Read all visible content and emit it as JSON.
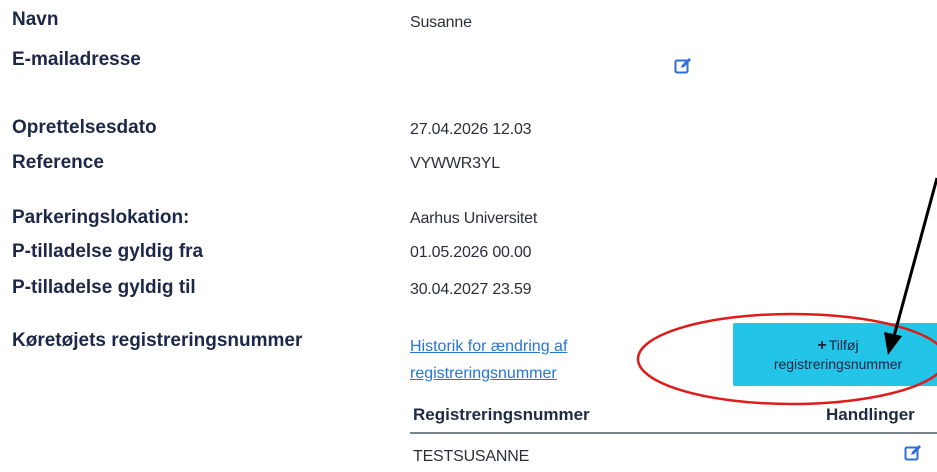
{
  "fields": {
    "name_label": "Navn",
    "name_value": "Susanne",
    "email_label": "E-mailadresse",
    "created_label": "Oprettelsesdato",
    "created_value": "27.04.2026 12.03",
    "reference_label": "Reference",
    "reference_value": "VYWWR3YL",
    "location_label": "Parkeringslokation:",
    "location_value": "Aarhus Universitet",
    "valid_from_label": "P-tilladelse gyldig fra",
    "valid_from_value": "01.05.2026 00.00",
    "valid_to_label": "P-tilladelse gyldig til",
    "valid_to_value": "30.04.2027 23.59",
    "plate_label": "Køretøjets registreringsnummer"
  },
  "history_link": {
    "line1": "Historik for ændring af",
    "line2": "registreringsnummer"
  },
  "add_button": {
    "plus": "+",
    "line1": "Tilføj",
    "line2": "registreringsnummer"
  },
  "table": {
    "headers": [
      "Registreringsnummer",
      "Handlinger"
    ],
    "rows": [
      {
        "plate": "TESTSUSANNE"
      }
    ]
  },
  "icons": {
    "email_edit": "edit-icon",
    "row_edit": "edit-icon"
  },
  "colors": {
    "label_text": "#1d2847",
    "link": "#2476d8",
    "button_bg": "#22c4e8",
    "annotation": "#e01b1b",
    "icon": "#2b6fd6"
  }
}
